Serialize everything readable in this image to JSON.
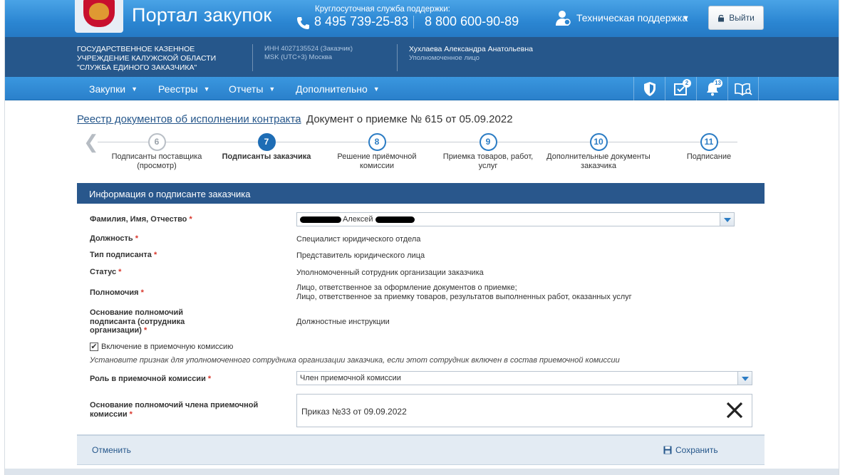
{
  "header": {
    "portal_title": "Портал закупок",
    "support_caption": "Круглосуточная служба поддержки:",
    "phone_primary": "8 495 739-25-83",
    "phone_secondary": "8 800 600-90-89",
    "tech_support_label": "Техническая поддержка",
    "logout_label": "Выйти"
  },
  "org": {
    "name": "ГОСУДАРСТВЕННОЕ КАЗЕННОЕ УЧРЕЖДЕНИЕ КАЛУЖСКОЙ ОБЛАСТИ \"СЛУЖБА ЕДИНОГО ЗАКАЗЧИКА\"",
    "inn": "ИНН 4027135524 (Заказчик)",
    "timezone": "MSK (UTC+3) Москва",
    "user_name": "Хухлаева Александра Анатольевна",
    "user_role": "Уполномоченное лицо"
  },
  "nav": {
    "items": [
      {
        "label": "Закупки"
      },
      {
        "label": "Реестры"
      },
      {
        "label": "Отчеты"
      },
      {
        "label": "Дополнительно"
      }
    ],
    "tasks_badge": "2",
    "notifications_badge": "13"
  },
  "breadcrumb": {
    "link": "Реестр документов об исполнении контракта",
    "current": "Документ о приемке № 615 от 05.09.2022"
  },
  "stepper": {
    "steps": [
      {
        "number": "6",
        "label": "Подписанты поставщика (просмотр)",
        "state": "done"
      },
      {
        "number": "7",
        "label": "Подписанты заказчика",
        "state": "active"
      },
      {
        "number": "8",
        "label": "Решение приёмочной комиссии",
        "state": "todo"
      },
      {
        "number": "9",
        "label": "Приемка товаров, работ, услуг",
        "state": "todo"
      },
      {
        "number": "10",
        "label": "Дополнительные документы заказчика",
        "state": "todo"
      },
      {
        "number": "11",
        "label": "Подписание",
        "state": "todo"
      }
    ]
  },
  "panel": {
    "title": "Информация о подписанте заказчика",
    "fields": {
      "fio_label": "Фамилия, Имя, Отчество",
      "fio_value": "Алексей",
      "position_label": "Должность",
      "position_value": "Специалист юридического отдела",
      "signer_type_label": "Тип подписанта",
      "signer_type_value": "Представитель юридического лица",
      "status_label": "Статус",
      "status_value": "Уполномоченный сотрудник организации заказчика",
      "authority_label": "Полномочия",
      "authority_value_1": "Лицо, ответственное за оформление документов о приемке;",
      "authority_value_2": "Лицо, ответственное за приемку товаров, результатов выполненных работ, оказанных услуг",
      "basis_label": "Основание полномочий подписанта (сотрудника организации)",
      "basis_value": "Должностные инструкции",
      "commission_checkbox_label": "Включение в приемочную комиссию",
      "commission_hint": "Установите признак для уполномоченного сотрудника организации заказчика, если этот сотрудник включен в состав приемочной комиссии",
      "role_label": "Роль в приемочной комиссии",
      "role_value": "Член приемочной комиссии",
      "member_basis_label": "Основание полномочий члена приемочной комиссии",
      "member_basis_value": "Приказ №33 от 09.09.2022"
    },
    "required_mark": "*"
  },
  "footer": {
    "cancel_label": "Отменить",
    "save_label": "Сохранить"
  }
}
